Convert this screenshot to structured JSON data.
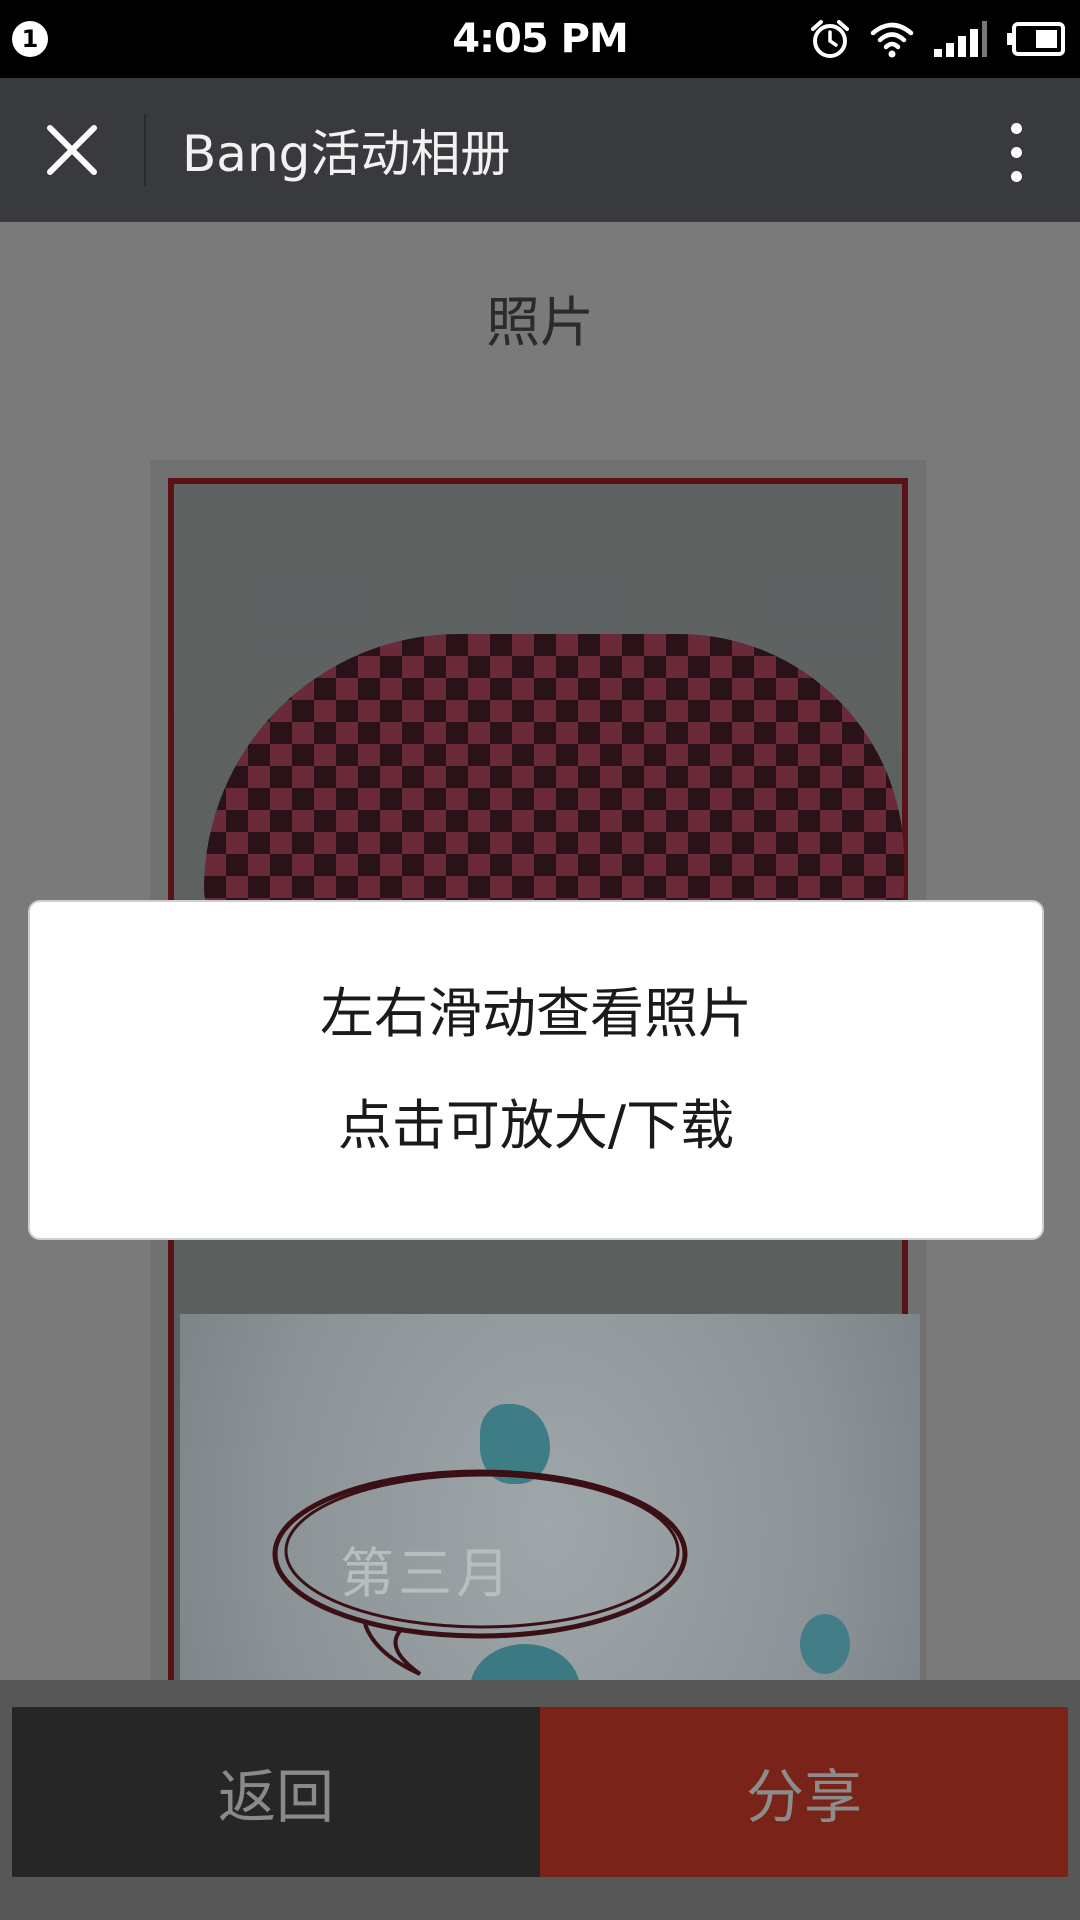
{
  "status_bar": {
    "notification_count": "1",
    "time": "4:05 PM",
    "icons": [
      "alarm-icon",
      "wifi-icon",
      "signal-icon",
      "battery-icon"
    ]
  },
  "app_bar": {
    "title": "Bang活动相册",
    "close_icon": "close-icon",
    "more_icon": "more-vertical-icon"
  },
  "page": {
    "section_title": "照片",
    "photo_caption": "第三月"
  },
  "toast": {
    "line1": "左右滑动查看照片",
    "line2": "点击可放大/下载"
  },
  "bottom_bar": {
    "back_label": "返回",
    "share_label": "分享"
  },
  "colors": {
    "header_bg": "#393a3e",
    "share_bg": "#7a2419",
    "back_bg": "#262626",
    "overlay_bg": "#7a7a7a"
  }
}
